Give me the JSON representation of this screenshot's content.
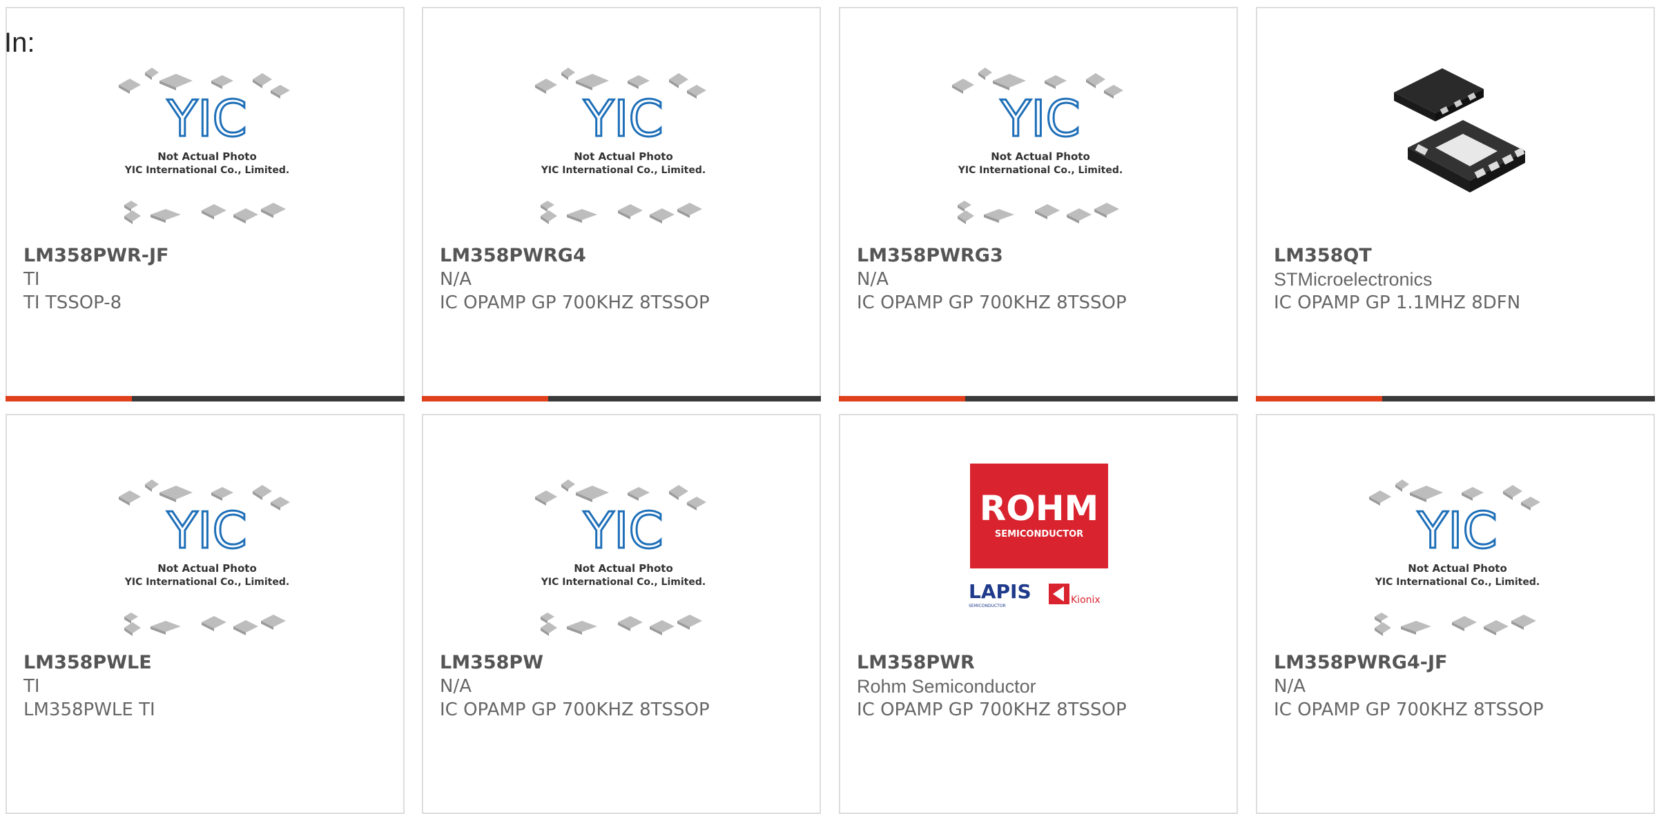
{
  "header": {
    "label": "In:"
  },
  "colors": {
    "accent_red": "#e0401c",
    "accent_dark": "#3a3a3a",
    "yic_blue": "#1e6fb8",
    "rohm_red": "#d9232e"
  },
  "placeholder": {
    "line1": "Not Actual Photo",
    "line2": "YIC International Co., Limited.",
    "logo": "YIC"
  },
  "rohm_image": {
    "title": "ROHM",
    "subtitle": "SEMICONDUCTOR",
    "lapis": "LAPIS",
    "lapis_sub": "SEMICONDUCTOR",
    "kionix": "Kionix"
  },
  "products": [
    {
      "part": "LM358PWR-JF",
      "maker": "TI",
      "desc": "TI TSSOP-8",
      "image": "yic-placeholder"
    },
    {
      "part": "LM358PWRG4",
      "maker": "N/A",
      "desc": "IC OPAMP GP 700KHZ 8TSSOP",
      "image": "yic-placeholder"
    },
    {
      "part": "LM358PWRG3",
      "maker": "N/A",
      "desc": "IC OPAMP GP 700KHZ 8TSSOP",
      "image": "yic-placeholder"
    },
    {
      "part": "LM358QT",
      "maker": "STMicroelectronics",
      "desc": "IC OPAMP GP 1.1MHZ 8DFN",
      "image": "dfn-chip-photo"
    },
    {
      "part": "LM358PWLE",
      "maker": "TI",
      "desc": "LM358PWLE TI",
      "image": "yic-placeholder"
    },
    {
      "part": "LM358PW",
      "maker": "N/A",
      "desc": "IC OPAMP GP 700KHZ 8TSSOP",
      "image": "yic-placeholder"
    },
    {
      "part": "LM358PWR",
      "maker": "Rohm Semiconductor",
      "desc": "IC OPAMP GP 700KHZ 8TSSOP",
      "image": "rohm-logo"
    },
    {
      "part": "LM358PWRG4-JF",
      "maker": "N/A",
      "desc": "IC OPAMP GP 700KHZ 8TSSOP",
      "image": "yic-placeholder"
    }
  ]
}
